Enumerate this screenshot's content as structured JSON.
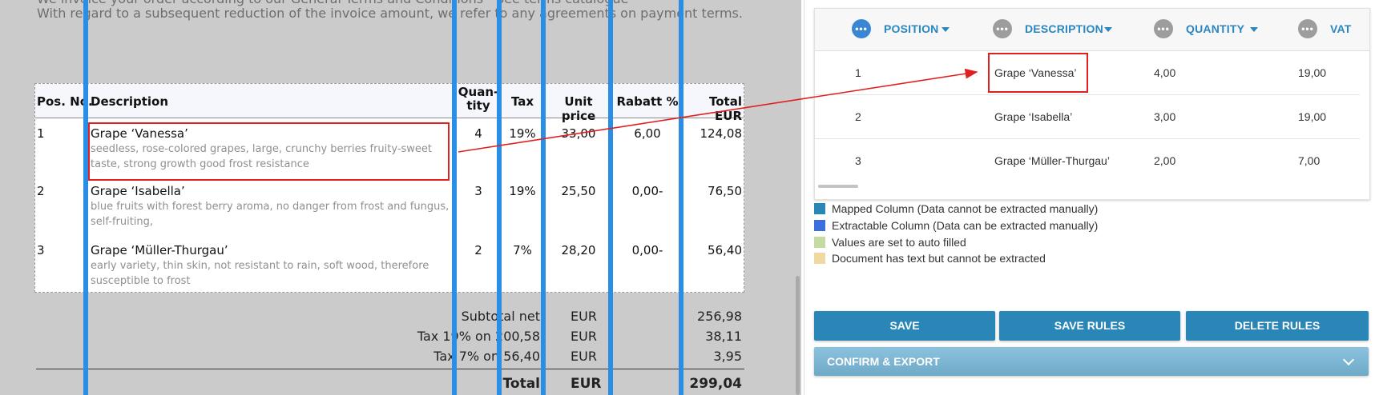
{
  "document": {
    "intro_line1": "We invoice your order according to our General Terms and Conditions - See terms catalogue",
    "intro_line2": "With regard to a subsequent reduction of the invoice amount, we refer to any agreements on payment terms.",
    "headers": {
      "pos": "Pos. No.",
      "desc": "Description",
      "qty_1": "Quan-",
      "qty_2": "tity",
      "tax": "Tax",
      "unit": "Unit price",
      "rabatt": "Rabatt %",
      "total": "Total EUR"
    },
    "rows": [
      {
        "pos": "1",
        "title": "Grape ‘Vanessa’",
        "detail": "seedless, rose-colored grapes, large, crunchy berries fruity-sweet taste, strong growth good frost resistance",
        "qty": "4",
        "tax": "19%",
        "unit": "33,00",
        "rabatt": "6,00",
        "total": "124,08"
      },
      {
        "pos": "2",
        "title": "Grape ‘Isabella’",
        "detail": "blue fruits with forest berry aroma, no danger from frost and fungus, self-fruiting,",
        "qty": "3",
        "tax": "19%",
        "unit": "25,50",
        "rabatt": "0,00-",
        "total": "76,50"
      },
      {
        "pos": "3",
        "title": "Grape ‘Müller-Thurgau’",
        "detail": "early variety, thin skin, not resistant to rain, soft wood, therefore susceptible to frost",
        "qty": "2",
        "tax": "7%",
        "unit": "28,20",
        "rabatt": "0,00-",
        "total": "56,40"
      }
    ],
    "summary": [
      {
        "label": "Subtotal net",
        "currency": "EUR",
        "value": "256,98"
      },
      {
        "label": "Tax 19% on 200,58",
        "currency": "EUR",
        "value": "38,11"
      },
      {
        "label": "Tax 7% on 56,40",
        "currency": "EUR",
        "value": "3,95"
      }
    ],
    "total": {
      "label": "Total",
      "currency": "EUR",
      "value": "299,04"
    }
  },
  "grid": {
    "columns": [
      "POSITION",
      "DESCRIPTION",
      "QUANTITY",
      "VAT"
    ],
    "rows": [
      {
        "position": "1",
        "description": "Grape ‘Vanessa’",
        "quantity": "4,00",
        "vat": "19,00"
      },
      {
        "position": "2",
        "description": "Grape ‘Isabella’",
        "quantity": "3,00",
        "vat": "19,00"
      },
      {
        "position": "3",
        "description": "Grape ‘Müller-Thurgau’",
        "quantity": "2,00",
        "vat": "7,00"
      }
    ]
  },
  "legend": [
    {
      "text": "Mapped Column (Data cannot be extracted manually)",
      "color": "#2a86b6"
    },
    {
      "text": "Extractable Column (Data can be extracted manually)",
      "color": "#3b6fe0"
    },
    {
      "text": "Values are set to auto filled",
      "color": "#c4dca4"
    },
    {
      "text": "Document has text but cannot be extracted",
      "color": "#f0d9a0"
    }
  ],
  "buttons": {
    "save": "SAVE",
    "save_rules": "SAVE RULES",
    "delete_rules": "DELETE RULES",
    "confirm_export": "CONFIRM & EXPORT"
  },
  "colors": {
    "column_line": "#2b8ee6",
    "highlight": "#e02020",
    "primary": "#2a86b6"
  }
}
